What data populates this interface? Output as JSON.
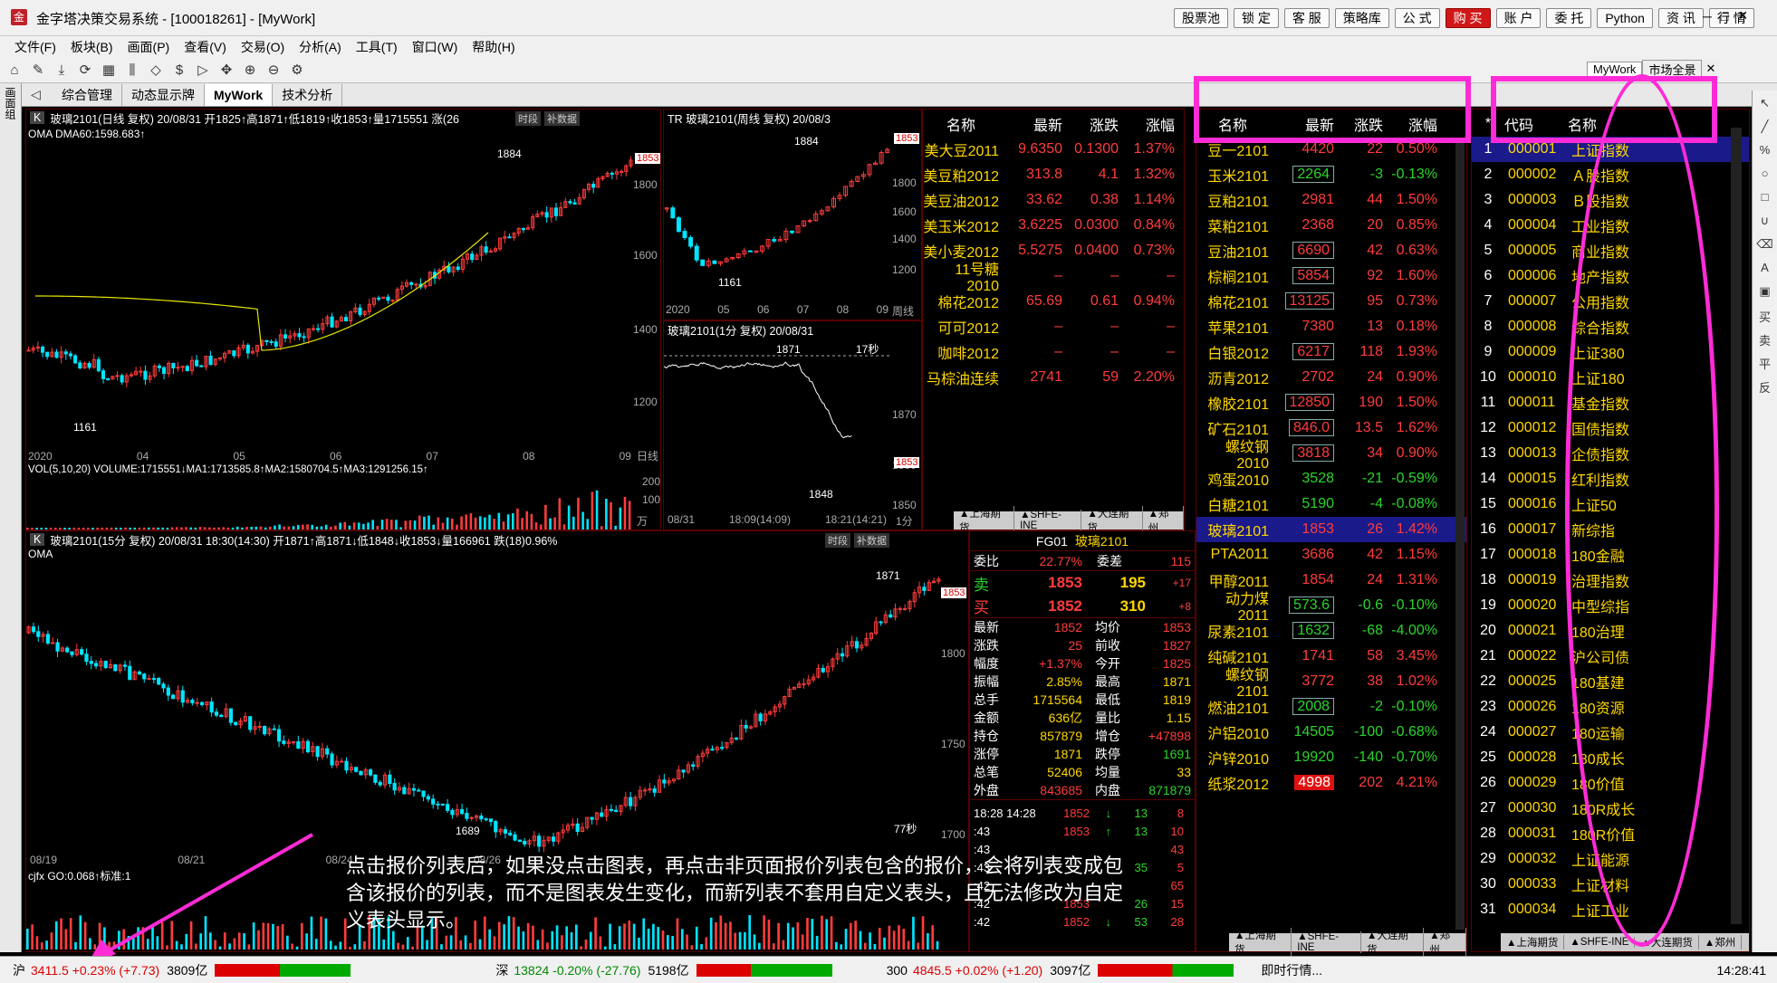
{
  "window": {
    "title": "金字塔决策交易系统 - [100018261] - [MyWork]",
    "logo": "金"
  },
  "top_buttons": [
    "股票池",
    "锁 定",
    "客 服",
    "策略库",
    "公 式",
    "购 买",
    "账 户",
    "委 托",
    "Python",
    "资 讯",
    "行 情"
  ],
  "menu": [
    "文件(F)",
    "板块(B)",
    "画面(P)",
    "查看(V)",
    "交易(O)",
    "分析(A)",
    "工具(T)",
    "窗口(W)",
    "帮助(H)"
  ],
  "tabs": [
    "综合管理",
    "动态显示牌",
    "MyWork",
    "技术分析"
  ],
  "right_tabs": [
    "MyWork",
    "市场全景"
  ],
  "left_vertical_label": "画面组",
  "chart_daily": {
    "head": "玻璃2101(日线 复权) 20/08/31 开1825↑高1871↑低1819↑收1853↑量1715551 涨(26",
    "sub": "OMA DMA60:1598.683↑",
    "y": [
      "1800",
      "1600",
      "1400",
      "1200"
    ],
    "x": [
      "2020",
      "04",
      "05",
      "06",
      "07",
      "08",
      "09"
    ],
    "mark_high": "1884",
    "mark_low": "1161",
    "price_tag": "1853",
    "vol_head": "VOL(5,10,20) VOLUME:1715551↓MA1:1713585.8↑MA2:1580704.5↑MA3:1291256.15↑",
    "vol_y": [
      "200",
      "100",
      "万"
    ],
    "btns": [
      "时段",
      "补数据"
    ],
    "axis_label": "日线"
  },
  "chart_weekly": {
    "head": "TR  玻璃2101(周线 复权) 20/08/3",
    "y": [
      "1800",
      "1600",
      "1400",
      "1200"
    ],
    "x": [
      "2020",
      "05",
      "06",
      "07",
      "08",
      "09"
    ],
    "mark_high": "1884",
    "mark_low": "1161",
    "price_tag": "1853",
    "axis_label": "周线"
  },
  "chart_min": {
    "head": "玻璃2101(1分 复权) 20/08/31",
    "y": [
      "1870",
      "1860",
      "1850"
    ],
    "x": [
      "08/31",
      "18:09(14:09)",
      "18:21(14:21)"
    ],
    "mark_high": "1871",
    "mark_low": "1848",
    "price_tag": "1853",
    "timer": "17秒",
    "axis_label": "1分"
  },
  "chart_15m": {
    "head": "玻璃2101(15分 复权) 20/08/31 18:30(14:30) 开1871↑高1871↓低1848↓收1853↓量166961 跌(18)0.96%",
    "sub": "OMA",
    "y": [
      "1800",
      "1750",
      "1700"
    ],
    "x": [
      "08/19",
      "08/21",
      "08/24",
      "08/26"
    ],
    "mark_high": "1871",
    "mark_low": "1689",
    "price_tag": "1853",
    "timer": "77秒",
    "ind": "cjfx GO:0.068↑标准:1",
    "btns": [
      "时段",
      "补数据"
    ]
  },
  "quote1": {
    "headers": [
      "名称",
      "最新",
      "涨跌",
      "涨幅"
    ],
    "rows": [
      [
        "美大豆2011",
        "9.6350",
        "0.1300",
        "1.37%"
      ],
      [
        "美豆粕2012",
        "313.8",
        "4.1",
        "1.32%"
      ],
      [
        "美豆油2012",
        "33.62",
        "0.38",
        "1.14%"
      ],
      [
        "美玉米2012",
        "3.6225",
        "0.0300",
        "0.84%"
      ],
      [
        "美小麦2012",
        "5.5275",
        "0.0400",
        "0.73%"
      ],
      [
        "11号糖2010",
        "–",
        "–",
        "–"
      ],
      [
        "棉花2012",
        "65.69",
        "0.61",
        "0.94%"
      ],
      [
        "可可2012",
        "–",
        "–",
        "–"
      ],
      [
        "咖啡2012",
        "–",
        "–",
        "–"
      ],
      [
        "马棕油连续",
        "2741",
        "59",
        "2.20%"
      ]
    ],
    "subtabs": [
      "▲上海期货",
      "▲SHFE-INE",
      "▲大连期货",
      "▲郑州"
    ]
  },
  "quote2": {
    "headers": [
      "名称",
      "最新",
      "涨跌",
      "涨幅"
    ],
    "rows": [
      [
        "豆一2101",
        "4420",
        "22",
        "0.50%"
      ],
      [
        "玉米2101",
        "2264",
        "-3",
        "-0.13%"
      ],
      [
        "豆粕2101",
        "2981",
        "44",
        "1.50%"
      ],
      [
        "菜粕2101",
        "2368",
        "20",
        "0.85%"
      ],
      [
        "豆油2101",
        "6690",
        "42",
        "0.63%"
      ],
      [
        "棕榈2101",
        "5854",
        "92",
        "1.60%"
      ],
      [
        "棉花2101",
        "13125",
        "95",
        "0.73%"
      ],
      [
        "苹果2101",
        "7380",
        "13",
        "0.18%"
      ],
      [
        "白银2012",
        "6217",
        "118",
        "1.93%"
      ],
      [
        "沥青2012",
        "2702",
        "24",
        "0.90%"
      ],
      [
        "橡胶2101",
        "12850",
        "190",
        "1.50%"
      ],
      [
        "矿石2101",
        "846.0",
        "13.5",
        "1.62%"
      ],
      [
        "螺纹钢2010",
        "3818",
        "34",
        "0.90%"
      ],
      [
        "鸡蛋2010",
        "3528",
        "-21",
        "-0.59%"
      ],
      [
        "白糖2101",
        "5190",
        "-4",
        "-0.08%"
      ],
      [
        "玻璃2101",
        "1853",
        "26",
        "1.42%"
      ],
      [
        "PTA2011",
        "3686",
        "42",
        "1.15%"
      ],
      [
        "甲醇2011",
        "1854",
        "24",
        "1.31%"
      ],
      [
        "动力煤2011",
        "573.6",
        "-0.6",
        "-0.10%"
      ],
      [
        "尿素2101",
        "1632",
        "-68",
        "-4.00%"
      ],
      [
        "纯碱2101",
        "1741",
        "58",
        "3.45%"
      ],
      [
        "螺纹钢2101",
        "3772",
        "38",
        "1.02%"
      ],
      [
        "燃油2101",
        "2008",
        "-2",
        "-0.10%"
      ],
      [
        "沪铝2010",
        "14505",
        "-100",
        "-0.68%"
      ],
      [
        "沪锌2010",
        "19920",
        "-140",
        "-0.70%"
      ],
      [
        "纸浆2012",
        "4998",
        "202",
        "4.21%"
      ]
    ],
    "subtabs": [
      "▲上海期货",
      "▲SHFE-INE",
      "▲大连期货",
      "▲郑州"
    ]
  },
  "quote3": {
    "headers": [
      "*",
      "代码",
      "名称"
    ],
    "rows": [
      [
        "1",
        "000001",
        "上证指数"
      ],
      [
        "2",
        "000002",
        "Ａ股指数"
      ],
      [
        "3",
        "000003",
        "Ｂ股指数"
      ],
      [
        "4",
        "000004",
        "工业指数"
      ],
      [
        "5",
        "000005",
        "商业指数"
      ],
      [
        "6",
        "000006",
        "地产指数"
      ],
      [
        "7",
        "000007",
        "公用指数"
      ],
      [
        "8",
        "000008",
        "综合指数"
      ],
      [
        "9",
        "000009",
        "上证380"
      ],
      [
        "10",
        "000010",
        "上证180"
      ],
      [
        "11",
        "000011",
        "基金指数"
      ],
      [
        "12",
        "000012",
        "国债指数"
      ],
      [
        "13",
        "000013",
        "企债指数"
      ],
      [
        "14",
        "000015",
        "红利指数"
      ],
      [
        "15",
        "000016",
        "上证50"
      ],
      [
        "16",
        "000017",
        "新综指"
      ],
      [
        "17",
        "000018",
        "180金融"
      ],
      [
        "18",
        "000019",
        "治理指数"
      ],
      [
        "19",
        "000020",
        "中型综指"
      ],
      [
        "20",
        "000021",
        "180治理"
      ],
      [
        "21",
        "000022",
        "沪公司债"
      ],
      [
        "22",
        "000025",
        "180基建"
      ],
      [
        "23",
        "000026",
        "180资源"
      ],
      [
        "24",
        "000027",
        "180运输"
      ],
      [
        "25",
        "000028",
        "180成长"
      ],
      [
        "26",
        "000029",
        "180价值"
      ],
      [
        "27",
        "000030",
        "180R成长"
      ],
      [
        "28",
        "000031",
        "180R价值"
      ],
      [
        "29",
        "000032",
        "上证能源"
      ],
      [
        "30",
        "000033",
        "上证材料"
      ],
      [
        "31",
        "000034",
        "上证工业"
      ]
    ],
    "subtabs": [
      "▲上海期货",
      "▲SHFE-INE",
      "▲大连期货",
      "▲郑州"
    ]
  },
  "detail": {
    "code": "FG01",
    "name": "玻璃2101",
    "weibi": [
      "委比",
      "22.77%",
      "委差",
      "115"
    ],
    "sell": [
      "卖",
      "1853",
      "195",
      "+17"
    ],
    "buy": [
      "买",
      "1852",
      "310",
      "+8"
    ],
    "stats": [
      [
        "最新",
        "1852",
        "均价",
        "1853"
      ],
      [
        "涨跌",
        "25",
        "前收",
        "1827"
      ],
      [
        "幅度",
        "+1.37%",
        "今开",
        "1825"
      ],
      [
        "振幅",
        "2.85%",
        "最高",
        "1871"
      ],
      [
        "总手",
        "1715564",
        "最低",
        "1819"
      ],
      [
        "金额",
        "636亿",
        "量比",
        "1.15"
      ],
      [
        "持仓",
        "857879",
        "增仓",
        "+47898"
      ],
      [
        "涨停",
        "1871",
        "跌停",
        "1691"
      ],
      [
        "总笔",
        "52406",
        "均量",
        "33"
      ],
      [
        "外盘",
        "843685",
        "内盘",
        "871879"
      ]
    ],
    "ticks": [
      [
        "18:28 14:28",
        "1852",
        "↓",
        "13",
        "8"
      ],
      [
        ":43",
        "1853",
        "↑",
        "13",
        "10"
      ],
      [
        ":43",
        "",
        "",
        "",
        "43"
      ],
      [
        ":43",
        "",
        "",
        "35",
        "5"
      ],
      [
        ":42",
        "",
        "",
        "",
        "65"
      ],
      [
        ":42",
        "1853",
        "",
        "26",
        "15"
      ],
      [
        ":42",
        "1852",
        "↓",
        "53",
        "28"
      ]
    ]
  },
  "overlay_note": "点击报价列表后，如果没点击图表，再点击非页面报价列表包含的报价，会将列表变成包含该报价的列表，而不是图表发生变化，而新列表不套用自定义表头，且无法修改为自定义表头显示。",
  "status": {
    "sh": "沪",
    "sh_val": "3411.5 +0.23% (+7.73)",
    "sh_amt": "3809亿",
    "sz": "深",
    "sz_val": "13824 -0.20% (-27.76)",
    "sz_amt": "5198亿",
    "i300": "300",
    "i300_val": "4845.5 +0.02% (+1.20)",
    "i300_amt": "3097亿",
    "right": "即时行情...",
    "time": "14:28:41"
  },
  "colors": {
    "magenta": "#ff2bd6",
    "up": "#ff3c3c",
    "down": "#2ad52a"
  }
}
